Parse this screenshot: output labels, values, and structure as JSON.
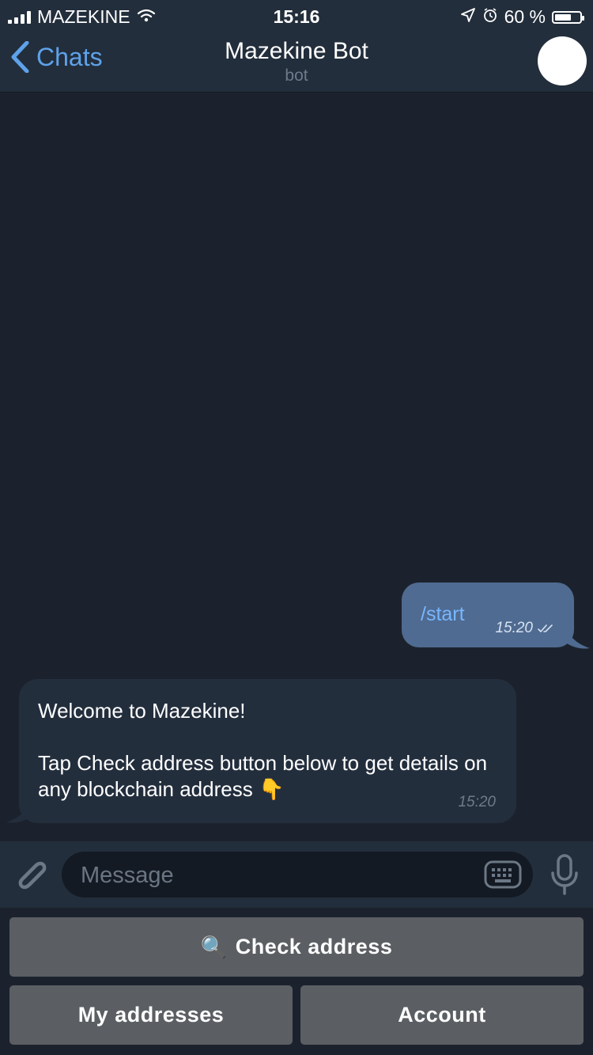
{
  "status_bar": {
    "carrier": "MAZEKINE",
    "time": "15:16",
    "battery_percent": "60 %",
    "icons": [
      "signal-icon",
      "wifi-icon",
      "location-icon",
      "alarm-icon",
      "battery-icon"
    ]
  },
  "nav": {
    "back_label": "Chats",
    "title": "Mazekine Bot",
    "subtitle": "bot"
  },
  "messages": [
    {
      "direction": "out",
      "text": "/start",
      "time": "15:20",
      "status": "read"
    },
    {
      "direction": "in",
      "paragraphs": [
        "Welcome to Mazekine!",
        "Tap Check address button below to get details on any blockchain address 👇"
      ],
      "time": "15:20"
    }
  ],
  "composer": {
    "placeholder": "Message",
    "icons": [
      "paperclip-icon",
      "keyboard-icon",
      "microphone-icon"
    ]
  },
  "bot_keyboard": {
    "rows": [
      [
        {
          "label": "Check address",
          "icon": "🔍"
        }
      ],
      [
        {
          "label": "My addresses"
        },
        {
          "label": "Account"
        }
      ]
    ]
  },
  "colors": {
    "background": "#1c222d",
    "header": "#232e3c",
    "accent": "#5ea2ea",
    "outgoing_bubble": "#4f6b91",
    "incoming_bubble": "#232e3d",
    "keyboard_button": "#5b5f63"
  }
}
